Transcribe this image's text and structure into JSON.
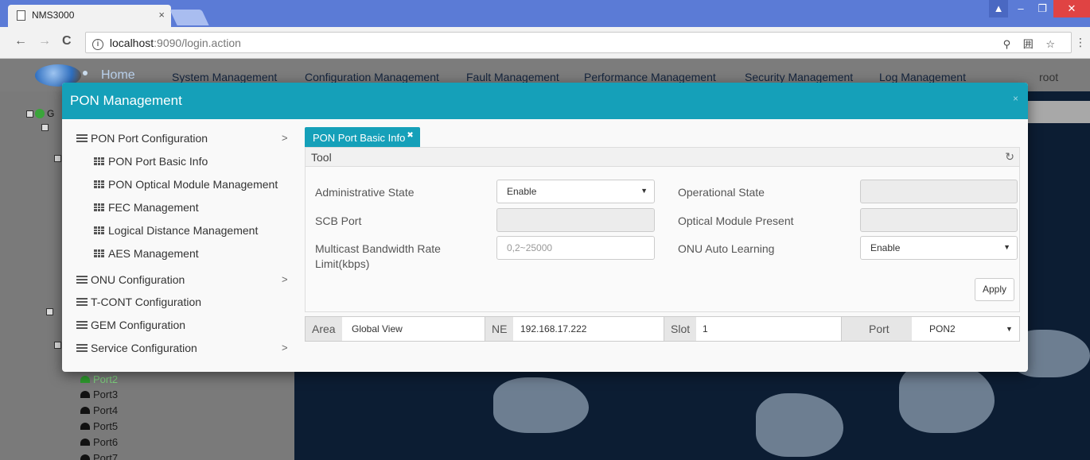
{
  "browser": {
    "tab_title": "NMS3000",
    "tab_close": "×",
    "url_host": "localhost",
    "url_path": ":9090/login.action",
    "info_glyph": "i",
    "right_icons": "⚲ 囲 ☆",
    "menu_glyph": "⋮",
    "back_glyph": "←",
    "forward_glyph": "→",
    "reload_glyph": "C",
    "win_user": "▲",
    "win_min": "–",
    "win_max": "❐",
    "win_close": "✕"
  },
  "app": {
    "menu": {
      "home": "Home",
      "system": "System Management",
      "configuration": "Configuration Management",
      "fault": "Fault Management",
      "performance": "Performance Management",
      "security": "Security Management",
      "log": "Log Management",
      "user": "root"
    },
    "tree": {
      "root_prefix": "G",
      "ports": [
        "Port2",
        "Port3",
        "Port4",
        "Port5",
        "Port6",
        "Port7"
      ]
    }
  },
  "modal": {
    "title": "PON Management",
    "close": "×",
    "sidebar": {
      "pon_port_config": "PON Port Configuration",
      "sub_items": [
        "PON Port Basic Info",
        "PON Optical Module Management",
        "FEC Management",
        "Logical Distance Management",
        "AES Management"
      ],
      "onu_config": "ONU Configuration",
      "tcont_config": "T-CONT Configuration",
      "gem_config": "GEM Configuration",
      "service_config": "Service Configuration",
      "chevron": ">"
    },
    "content": {
      "active_tab": "PON Port Basic Info",
      "tab_close": "✖",
      "tool_label": "Tool",
      "refresh_glyph": "↻",
      "form": {
        "admin_state_label": "Administrative State",
        "admin_state_value": "Enable",
        "operational_state_label": "Operational State",
        "operational_state_value": "",
        "scb_port_label": "SCB Port",
        "scb_port_value": "",
        "optical_module_label": "Optical Module Present",
        "optical_module_value": "",
        "multicast_label": "Multicast Bandwidth Rate Limit(kbps)",
        "multicast_placeholder": "0,2~25000",
        "onu_auto_label": "ONU Auto Learning",
        "onu_auto_value": "Enable",
        "caret": "▼",
        "apply_button": "Apply"
      },
      "filter": {
        "area_label": "Area",
        "area_value": "Global View",
        "ne_label": "NE",
        "ne_value": "192.168.17.222",
        "slot_label": "Slot",
        "slot_value": "1",
        "port_label": "Port",
        "port_value": "PON2"
      }
    }
  },
  "colors": {
    "modal_header": "#15a0b9",
    "browser_tabbar": "#5b7bd6",
    "close_button": "#e04343"
  }
}
